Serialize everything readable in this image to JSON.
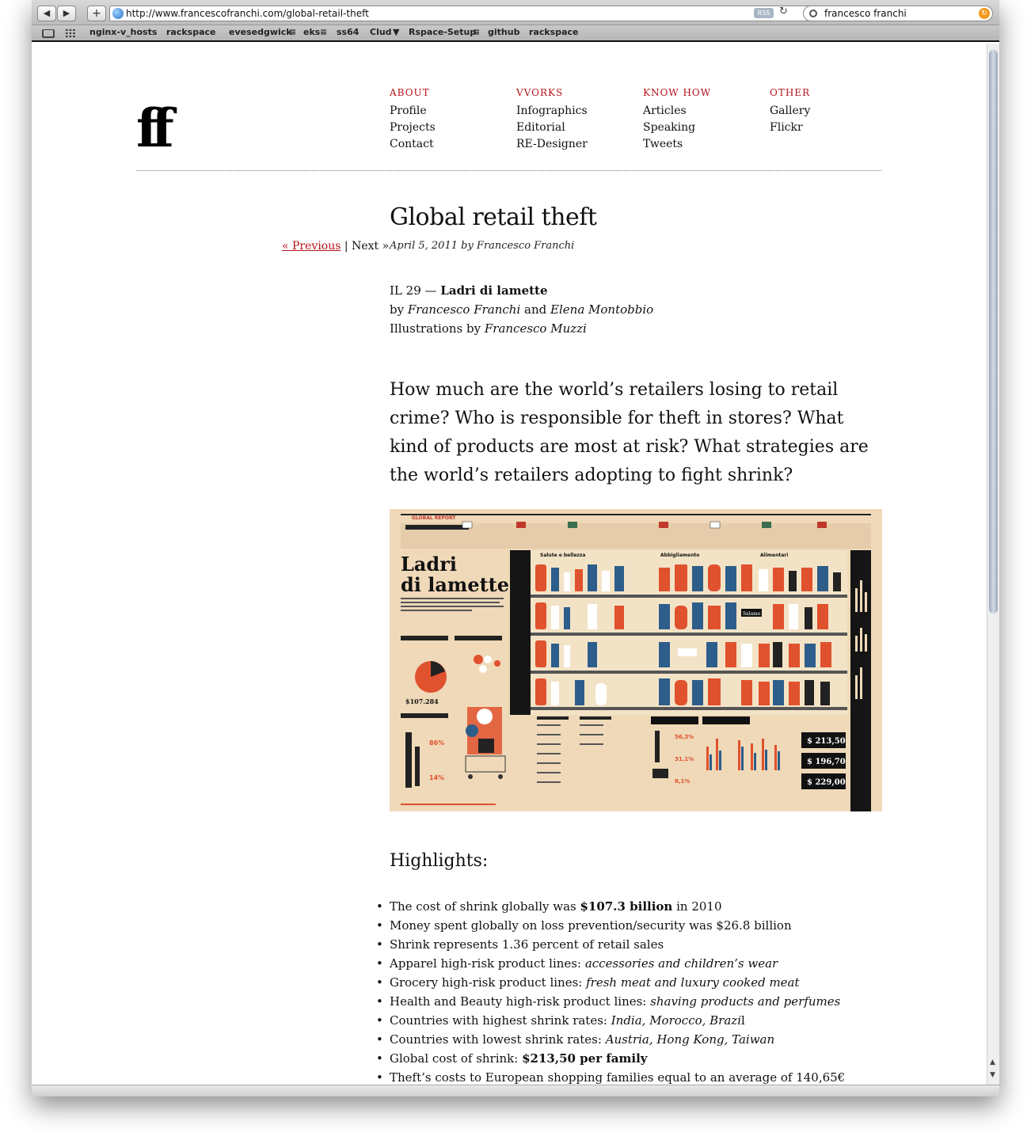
{
  "browser": {
    "url": "http://www.francescofranchi.com/global-retail-theft",
    "rss_label": "RSS",
    "search_value": "francesco franchi",
    "bookmarks": [
      "nginx-v_hosts",
      "rackspace",
      "evesedgwick",
      "eks",
      "ss64",
      "Clud",
      "Rspace-Setup",
      "github",
      "rackspace"
    ]
  },
  "site": {
    "logo": "ff",
    "nav": [
      {
        "heading": "ABOUT",
        "links": [
          "Profile",
          "Projects",
          "Contact"
        ]
      },
      {
        "heading": "VVORKS",
        "links": [
          "Infographics",
          "Editorial",
          "RE-Designer"
        ]
      },
      {
        "heading": "KNOW HOW",
        "links": [
          "Articles",
          "Speaking",
          "Tweets"
        ]
      },
      {
        "heading": "OTHER",
        "links": [
          "Gallery",
          "Flickr"
        ]
      }
    ]
  },
  "pager": {
    "previous": "« Previous",
    "separator": "|",
    "next": "Next »"
  },
  "post": {
    "title": "Global retail theft",
    "meta": "April 5, 2011 by Francesco Franchi",
    "credit_prefix": "IL 29 —",
    "credit_title": "Ladri di lamette",
    "credit_by": "by",
    "author1": "Francesco Franchi",
    "and": "and",
    "author2": "Elena Montobbio",
    "illus_prefix": "Illustrations by",
    "illustrator": "Francesco Muzzi",
    "lead": "How much are the world’s retailers losing to retail crime? Who is responsible for theft in stores? What kind of products are most at risk? What strategies are the world’s retailers adopting to fight shrink?"
  },
  "infographic": {
    "heading_line1": "Ladri",
    "heading_line2": "di lamette",
    "section_label": "GLOBAL REPORT",
    "prices": [
      "$ 213,50",
      "$ 196,70",
      "$ 229,00"
    ],
    "total_label": "$107.284",
    "percents": [
      "86%",
      "14%",
      "56,3%",
      "31,1%",
      "8,1%"
    ],
    "category_labels": [
      "Salute e bellezza",
      "Abbigliamento",
      "Alimentari"
    ],
    "shelf_tag": "Salame"
  },
  "highlights": {
    "title": "Highlights:",
    "items": [
      {
        "pre": "The cost of shrink globally was ",
        "b": "$107.3 billion",
        "i": "",
        "post": " in 2010"
      },
      {
        "pre": "Money spent globally on loss prevention/security was $26.8 billion",
        "b": "",
        "i": "",
        "post": ""
      },
      {
        "pre": "Shrink represents 1.36 percent of retail sales",
        "b": "",
        "i": "",
        "post": ""
      },
      {
        "pre": "Apparel high-risk product lines: ",
        "b": "",
        "i": "accessories and children’s wear",
        "post": ""
      },
      {
        "pre": "Grocery high-risk product lines: ",
        "b": "",
        "i": "fresh meat and luxury cooked meat",
        "post": ""
      },
      {
        "pre": "Health and Beauty high-risk product lines: ",
        "b": "",
        "i": "shaving products and perfumes",
        "post": ""
      },
      {
        "pre": "Countries with highest shrink rates: ",
        "b": "",
        "i": "India, Morocco, Brazi",
        "post": "l"
      },
      {
        "pre": "Countries with lowest shrink rates: ",
        "b": "",
        "i": "Austria, Hong Kong, Taiwan",
        "post": ""
      },
      {
        "pre": "Global cost of shrink: ",
        "b": "$213,50 per family",
        "i": "",
        "post": ""
      },
      {
        "pre": "Theft’s costs to European shopping families equal to an average of 140,65€",
        "b": "",
        "i": "",
        "post": ""
      }
    ]
  }
}
